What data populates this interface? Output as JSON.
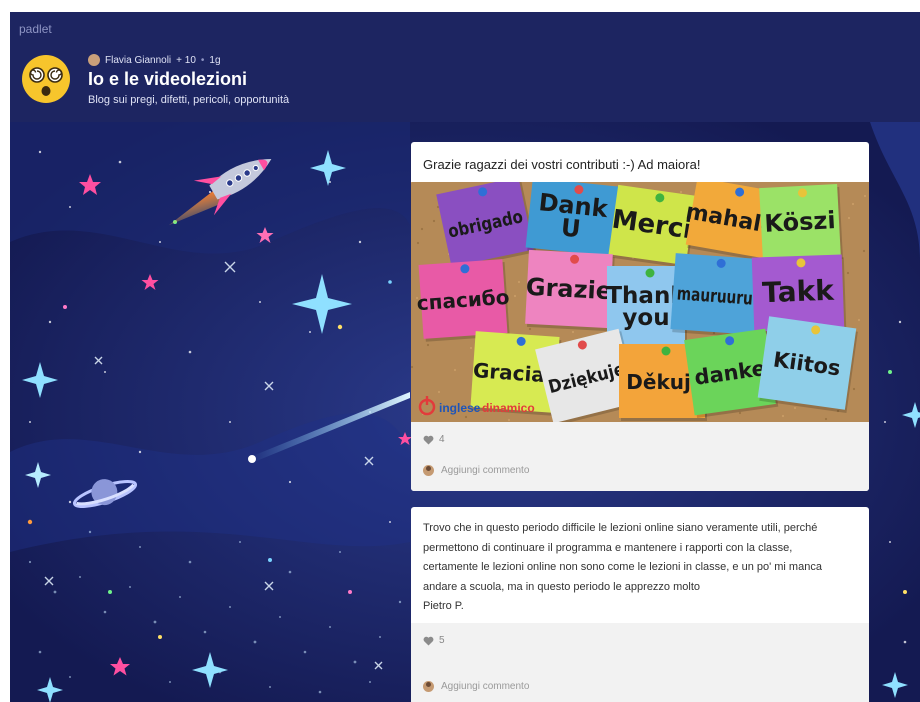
{
  "app": {
    "brand": "padlet"
  },
  "wall": {
    "author": "Flavia Giannoli",
    "plus": "+ 10",
    "separator": "•",
    "age": "1g",
    "title": "Io e le videolezioni",
    "subtitle": "Blog sui pregi, difetti, pericoli, opportunità"
  },
  "posts": [
    {
      "title": "Grazie ragazzi dei vostri contributi :-) Ad maiora!",
      "image": {
        "notes": [
          {
            "text": "obrigado",
            "color": "#8a4fc1"
          },
          {
            "text": "Dank U",
            "color": "#3f9ad3"
          },
          {
            "text": "Merci",
            "color": "#cfe54a"
          },
          {
            "text": "mahalo",
            "color": "#f2a93a"
          },
          {
            "text": "Köszi",
            "color": "#9be267"
          },
          {
            "text": "спасибо",
            "color": "#e85aa6"
          },
          {
            "text": "Grazie",
            "color": "#ee84c0"
          },
          {
            "text": "Thank you",
            "color": "#8fc7ee"
          },
          {
            "text": "mauruuru",
            "color": "#4ea3d9"
          },
          {
            "text": "Takk",
            "color": "#a45ad0"
          },
          {
            "text": "Gracias",
            "color": "#d7ea52"
          },
          {
            "text": "Dziękuję",
            "color": "#e7e7e7"
          },
          {
            "text": "Děkuji",
            "color": "#f3a43a"
          },
          {
            "text": "danke",
            "color": "#6bd45a"
          },
          {
            "text": "Kiitos",
            "color": "#8fcfe9"
          }
        ],
        "watermark_a": "inglese",
        "watermark_b": "dinamico"
      },
      "likes": "4",
      "comment_placeholder": "Aggiungi commento"
    },
    {
      "body_lines": [
        "Trovo che in questo periodo difficile le lezioni online siano veramente utili, perché",
        "permettono di continuare il programma e mantenere i rapporti con la classe,",
        "certamente le lezioni online non sono come le lezioni in classe, e un po' mi manca",
        "andare a scuola, ma in questo periodo le apprezzo molto",
        "Pietro P."
      ],
      "likes": "5",
      "comment_placeholder": "Aggiungi commento"
    }
  ],
  "colors": {
    "header": "#1d2561",
    "space": "#1b2462",
    "card": "#ffffff",
    "footer": "#f2f2f2"
  }
}
